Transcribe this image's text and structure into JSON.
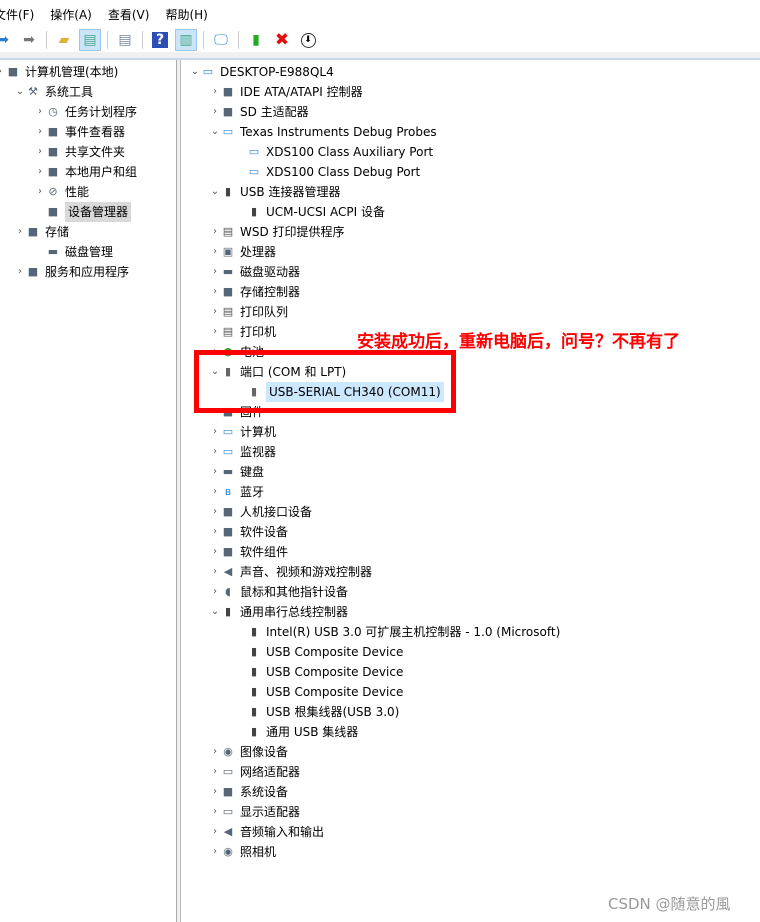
{
  "menubar": [
    "文件(F)",
    "操作(A)",
    "查看(V)",
    "帮助(H)"
  ],
  "toolbar": [
    "back-icon",
    "forward-icon",
    "up-folder-icon",
    "show-hide-tree-icon",
    "properties-icon",
    "help-icon",
    "action-pane-icon",
    "scan-hardware-icon",
    "update-driver-icon",
    "uninstall-icon",
    "disable-icon"
  ],
  "left_tree": [
    {
      "label": "计算机管理(本地)",
      "level": 0,
      "icon": "computer-management-icon"
    },
    {
      "label": "系统工具",
      "level": 1,
      "icon": "tools-icon",
      "expanded": true
    },
    {
      "label": "任务计划程序",
      "level": 2,
      "icon": "clock-icon"
    },
    {
      "label": "事件查看器",
      "level": 2,
      "icon": "event-viewer-icon"
    },
    {
      "label": "共享文件夹",
      "level": 2,
      "icon": "shared-folder-icon"
    },
    {
      "label": "本地用户和组",
      "level": 2,
      "icon": "users-icon"
    },
    {
      "label": "性能",
      "level": 2,
      "icon": "performance-icon"
    },
    {
      "label": "设备管理器",
      "level": 2,
      "icon": "device-manager-icon",
      "selected": true,
      "nochev": true
    },
    {
      "label": "存储",
      "level": 1,
      "icon": "storage-icon"
    },
    {
      "label": "磁盘管理",
      "level": 2,
      "icon": "disk-icon",
      "nochev": true
    },
    {
      "label": "服务和应用程序",
      "level": 1,
      "icon": "services-icon"
    }
  ],
  "device_tree": [
    {
      "label": "DESKTOP-E988QL4",
      "level": 0,
      "icon": "computer-icon",
      "expanded": true
    },
    {
      "label": "IDE ATA/ATAPI 控制器",
      "level": 1,
      "icon": "ide-icon"
    },
    {
      "label": "SD 主适配器",
      "level": 1,
      "icon": "sd-icon"
    },
    {
      "label": "Texas Instruments Debug Probes",
      "level": 1,
      "icon": "monitor-icon",
      "expanded": true
    },
    {
      "label": "XDS100 Class Auxiliary Port",
      "level": 2,
      "icon": "monitor-icon"
    },
    {
      "label": "XDS100 Class Debug Port",
      "level": 2,
      "icon": "monitor-icon"
    },
    {
      "label": "USB 连接器管理器",
      "level": 1,
      "icon": "usb-icon",
      "expanded": true
    },
    {
      "label": "UCM-UCSI ACPI 设备",
      "level": 2,
      "icon": "usb-icon"
    },
    {
      "label": "WSD 打印提供程序",
      "level": 1,
      "icon": "printer-icon"
    },
    {
      "label": "处理器",
      "level": 1,
      "icon": "cpu-icon"
    },
    {
      "label": "磁盘驱动器",
      "level": 1,
      "icon": "disk-icon"
    },
    {
      "label": "存储控制器",
      "level": 1,
      "icon": "storage-controller-icon"
    },
    {
      "label": "打印队列",
      "level": 1,
      "icon": "printer-icon"
    },
    {
      "label": "打印机",
      "level": 1,
      "icon": "printer-icon"
    },
    {
      "label": "电池",
      "level": 1,
      "icon": "battery-icon"
    },
    {
      "label": "端口 (COM 和 LPT)",
      "level": 1,
      "icon": "port-icon",
      "expanded": true
    },
    {
      "label": "USB-SERIAL CH340 (COM11)",
      "level": 2,
      "icon": "port-icon",
      "selected": true
    },
    {
      "label": "固件",
      "level": 1,
      "icon": "firmware-icon"
    },
    {
      "label": "计算机",
      "level": 1,
      "icon": "computer-icon"
    },
    {
      "label": "监视器",
      "level": 1,
      "icon": "monitor-icon"
    },
    {
      "label": "键盘",
      "level": 1,
      "icon": "keyboard-icon"
    },
    {
      "label": "蓝牙",
      "level": 1,
      "icon": "bluetooth-icon"
    },
    {
      "label": "人机接口设备",
      "level": 1,
      "icon": "hid-icon"
    },
    {
      "label": "软件设备",
      "level": 1,
      "icon": "software-device-icon"
    },
    {
      "label": "软件组件",
      "level": 1,
      "icon": "software-component-icon"
    },
    {
      "label": "声音、视频和游戏控制器",
      "level": 1,
      "icon": "speaker-icon"
    },
    {
      "label": "鼠标和其他指针设备",
      "level": 1,
      "icon": "mouse-icon"
    },
    {
      "label": "通用串行总线控制器",
      "level": 1,
      "icon": "usb-icon",
      "expanded": true
    },
    {
      "label": "Intel(R) USB 3.0 可扩展主机控制器 - 1.0 (Microsoft)",
      "level": 2,
      "icon": "usb-icon"
    },
    {
      "label": "USB Composite Device",
      "level": 2,
      "icon": "usb-icon"
    },
    {
      "label": "USB Composite Device",
      "level": 2,
      "icon": "usb-icon"
    },
    {
      "label": "USB Composite Device",
      "level": 2,
      "icon": "usb-icon"
    },
    {
      "label": "USB 根集线器(USB 3.0)",
      "level": 2,
      "icon": "usb-icon"
    },
    {
      "label": "通用 USB 集线器",
      "level": 2,
      "icon": "usb-icon"
    },
    {
      "label": "图像设备",
      "level": 1,
      "icon": "camera-icon"
    },
    {
      "label": "网络适配器",
      "level": 1,
      "icon": "network-icon"
    },
    {
      "label": "系统设备",
      "level": 1,
      "icon": "system-device-icon"
    },
    {
      "label": "显示适配器",
      "level": 1,
      "icon": "display-icon"
    },
    {
      "label": "音频输入和输出",
      "level": 1,
      "icon": "speaker-icon"
    },
    {
      "label": "照相机",
      "level": 1,
      "icon": "webcam-icon"
    }
  ],
  "annotation": {
    "text": "安装成功后，重新电脑后，问号？不再有了",
    "color": "#ff0000"
  },
  "watermark": "CSDN @随意的風"
}
